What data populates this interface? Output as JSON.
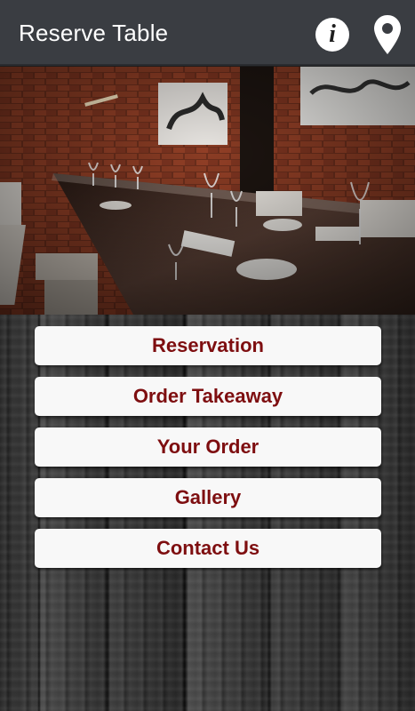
{
  "app_bar": {
    "title": "Reserve Table",
    "icons": [
      "info-icon",
      "location-pin-icon"
    ]
  },
  "hero": {
    "image": "restaurant dining room with long glass-top table, wine glasses, white chairs and exposed brick walls"
  },
  "menu": {
    "items": [
      {
        "label": "Reservation"
      },
      {
        "label": "Order Takeaway"
      },
      {
        "label": "Your Order"
      },
      {
        "label": "Gallery"
      },
      {
        "label": "Contact Us"
      }
    ]
  },
  "colors": {
    "app_bar": "#3a3d42",
    "button_bg": "#f8f8f8",
    "button_text": "#7e0e10"
  }
}
